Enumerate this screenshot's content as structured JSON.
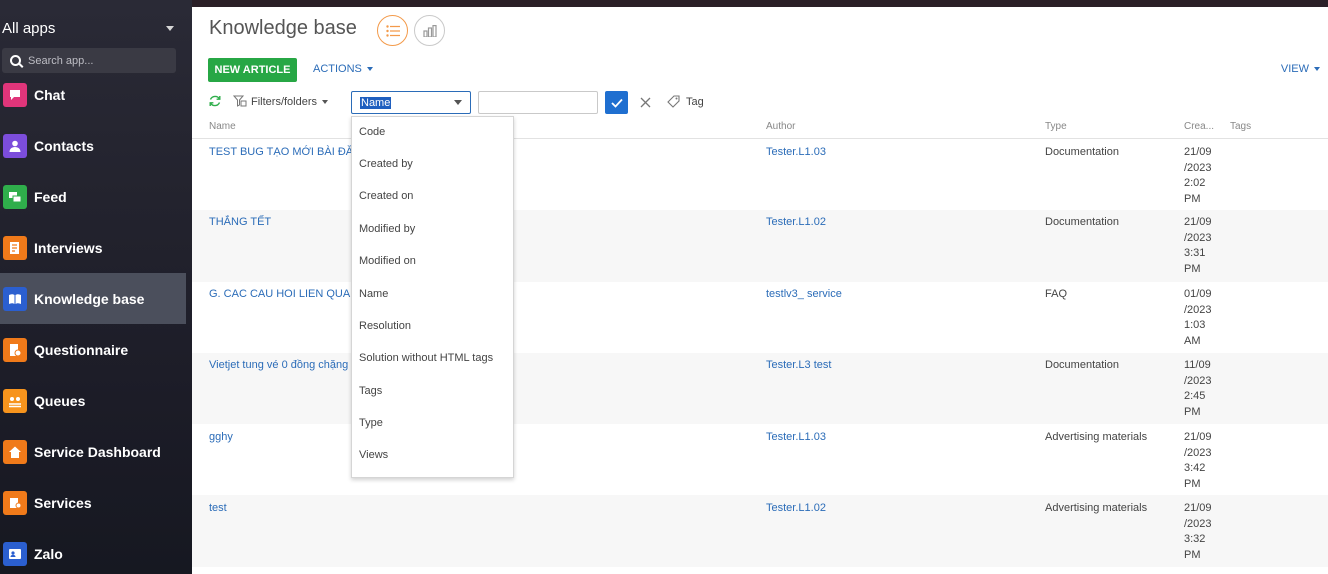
{
  "sidebar": {
    "title": "All apps",
    "search_placeholder": "Search app...",
    "items": [
      {
        "label": "Chat",
        "color": "#e0357a"
      },
      {
        "label": "Contacts",
        "color": "#7c4ddb"
      },
      {
        "label": "Feed",
        "color": "#2fae4b"
      },
      {
        "label": "Interviews",
        "color": "#f07a1a"
      },
      {
        "label": "Knowledge base",
        "color": "#2b5fd0",
        "active": true
      },
      {
        "label": "Questionnaire",
        "color": "#f07a1a"
      },
      {
        "label": "Queues",
        "color": "#f7941d"
      },
      {
        "label": "Service Dashboard",
        "color": "#f07a1a"
      },
      {
        "label": "Services",
        "color": "#f07a1a"
      },
      {
        "label": "Zalo",
        "color": "#2b5fd0"
      }
    ]
  },
  "header": {
    "title": "Knowledge base",
    "new_article": "NEW ARTICLE",
    "actions": "ACTIONS",
    "view": "VIEW"
  },
  "filters": {
    "filters_label": "Filters/folders",
    "column_selected": "Name",
    "value": "",
    "tag_label": "Tag"
  },
  "columns": {
    "name": "Name",
    "author": "Author",
    "type": "Type",
    "created": "Crea...",
    "tags": "Tags"
  },
  "rows": [
    {
      "name": "TEST BUG TẠO MỚI BÀI ĐĂNG",
      "author": "Tester.L1.03",
      "type": "Documentation",
      "created": [
        "21/09",
        "/2023",
        "2:02",
        "PM"
      ]
    },
    {
      "name": "THẮNG TẾT",
      "author": "Tester.L1.02",
      "type": "Documentation",
      "created": [
        "21/09",
        "/2023",
        "3:31",
        "PM"
      ]
    },
    {
      "name": "G. CAC CAU HOI LIEN QUAN D",
      "author": "testlv3_ service",
      "type": "FAQ",
      "created": [
        "01/09",
        "/2023",
        "1:03",
        "AM"
      ]
    },
    {
      "name": "Vietjet tung vé 0 đồng chặng b",
      "author": "Tester.L3 test",
      "type": "Documentation",
      "created": [
        "11/09",
        "/2023",
        "2:45",
        "PM"
      ]
    },
    {
      "name": "gghy",
      "author": "Tester.L1.03",
      "type": "Advertising materials",
      "created": [
        "21/09",
        "/2023",
        "3:42",
        "PM"
      ]
    },
    {
      "name": "test",
      "author": "Tester.L1.02",
      "type": "Advertising materials",
      "created": [
        "21/09",
        "/2023",
        "3:32",
        "PM"
      ]
    }
  ],
  "dropdown_options": [
    "Code",
    "Created by",
    "Created on",
    "Modified by",
    "Modified on",
    "Name",
    "Resolution",
    "Solution without HTML tags",
    "Tags",
    "Type",
    "Views"
  ]
}
